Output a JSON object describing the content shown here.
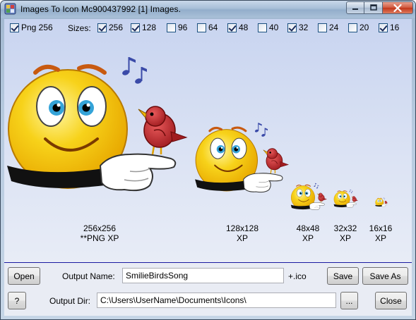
{
  "window": {
    "title": "Images To Icon    Mc900437992  [1] Images."
  },
  "options": {
    "png_label": "Png 256",
    "png_checked": true,
    "sizes_label": "Sizes:",
    "sizes": [
      {
        "label": "256",
        "checked": true
      },
      {
        "label": "128",
        "checked": true
      },
      {
        "label": "96",
        "checked": false
      },
      {
        "label": "64",
        "checked": false
      },
      {
        "label": "48",
        "checked": true
      },
      {
        "label": "40",
        "checked": false
      },
      {
        "label": "32",
        "checked": true
      },
      {
        "label": "24",
        "checked": false
      },
      {
        "label": "20",
        "checked": false
      },
      {
        "label": "16",
        "checked": true
      }
    ]
  },
  "previews": [
    {
      "size": "256x256",
      "format": "**PNG XP"
    },
    {
      "size": "128x128",
      "format": "XP"
    },
    {
      "size": "48x48",
      "format": "XP"
    },
    {
      "size": "32x32",
      "format": "XP"
    },
    {
      "size": "16x16",
      "format": "XP"
    }
  ],
  "controls": {
    "open_label": "Open",
    "output_name_label": "Output Name:",
    "output_name_value": "SmilieBirdsSong",
    "extension_label": "+.ico",
    "save_label": "Save",
    "save_as_label": "Save As",
    "help_label": "?",
    "output_dir_label": "Output Dir:",
    "output_dir_value": "C:\\Users\\UserName\\Documents\\Icons\\",
    "browse_label": "...",
    "close_label": "Close"
  },
  "icons": {
    "app": "images-to-icon-app-icon",
    "minimize": "minimize-icon",
    "maximize": "maximize-icon",
    "close": "close-icon",
    "preview": "smiley-bird-icon"
  },
  "colors": {
    "face": "#f7c600",
    "bird": "#c6282d",
    "accent": "#1a1aa0"
  }
}
